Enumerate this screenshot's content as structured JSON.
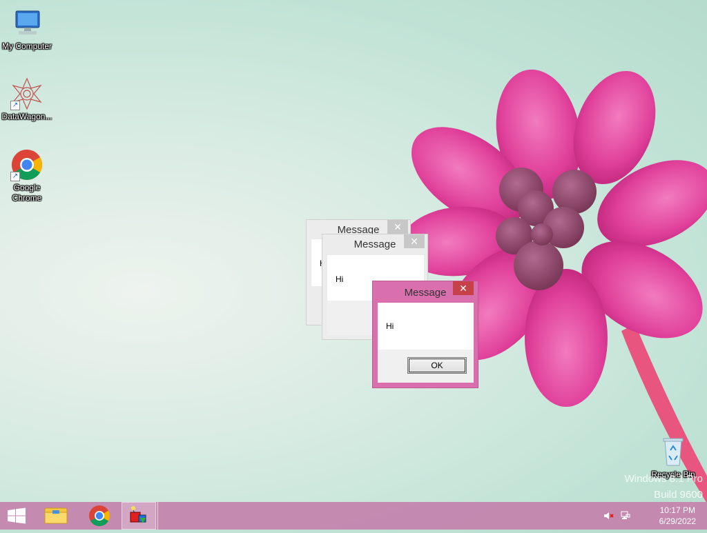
{
  "desktop": {
    "icons": [
      {
        "label": "My Computer",
        "icon": "computer-icon"
      },
      {
        "label": "DataWagon...",
        "icon": "datawagon-icon"
      },
      {
        "label": "Google Chrome",
        "icon": "chrome-icon"
      },
      {
        "label": "Recycle Bin",
        "icon": "recycle-bin-icon"
      }
    ],
    "watermark": {
      "line1": "Windows 8.1 Pro",
      "line2": "Build 9600"
    }
  },
  "dialogs": [
    {
      "title": "Message",
      "message": "Hi",
      "close": "✕"
    },
    {
      "title": "Message",
      "message": "Hi",
      "close": "✕"
    },
    {
      "title": "Message",
      "message": "Hi",
      "close": "✕",
      "ok_label": "OK"
    }
  ],
  "taskbar": {
    "items": [
      "start-icon",
      "file-explorer-icon",
      "chrome-icon",
      "app-icon"
    ],
    "tray": [
      "volume-muted-icon",
      "network-icon"
    ],
    "time": "10:17 PM",
    "date": "6/29/2022"
  },
  "colors": {
    "accent": "#d970ad",
    "close": "#c74248",
    "taskbar": "#c482ac"
  }
}
